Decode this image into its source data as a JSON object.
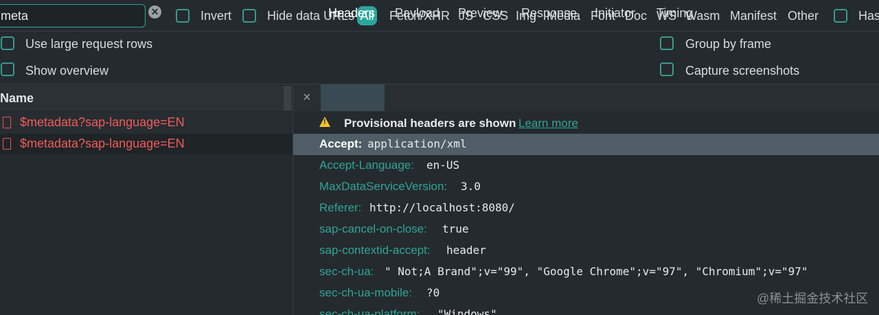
{
  "filter": {
    "search_value": "meta",
    "invert_label": "Invert",
    "hide_data_urls_label": "Hide data URLs",
    "types": [
      "All",
      "Fetch/XHR",
      "JS",
      "CSS",
      "Img",
      "Media",
      "Font",
      "Doc",
      "WS",
      "Wasm",
      "Manifest",
      "Other"
    ],
    "has_label": "Has"
  },
  "options": {
    "large_rows_label": "Use large request rows",
    "show_overview_label": "Show overview",
    "group_by_frame_label": "Group by frame",
    "capture_screenshots_label": "Capture screenshots"
  },
  "requests": {
    "column_name": "Name",
    "rows": [
      "$metadata?sap-language=EN",
      "$metadata?sap-language=EN"
    ]
  },
  "detail": {
    "tabs": [
      "Headers",
      "Payload",
      "Preview",
      "Response",
      "Initiator",
      "Timing"
    ],
    "warning_text": "Provisional headers are shown",
    "learn_more": "Learn more",
    "headers": [
      {
        "key": "Accept:",
        "value": "application/xml"
      },
      {
        "key": "Accept-Language:",
        "value": "en-US"
      },
      {
        "key": "MaxDataServiceVersion:",
        "value": "3.0"
      },
      {
        "key": "Referer:",
        "value": "http://localhost:8080/"
      },
      {
        "key": "sap-cancel-on-close:",
        "value": "true"
      },
      {
        "key": "sap-contextid-accept:",
        "value": "header"
      },
      {
        "key": "sec-ch-ua:",
        "value": "\" Not;A Brand\";v=\"99\", \"Google Chrome\";v=\"97\", \"Chromium\";v=\"97\""
      },
      {
        "key": "sec-ch-ua-mobile:",
        "value": "?0"
      },
      {
        "key": "sec-ch-ua-platform:",
        "value": "\"Windows\""
      }
    ]
  },
  "watermark": "@稀土掘金技术社区",
  "colors": {
    "accent": "#2aa79a",
    "error": "#ef5b5b",
    "background": "#252a2e"
  }
}
